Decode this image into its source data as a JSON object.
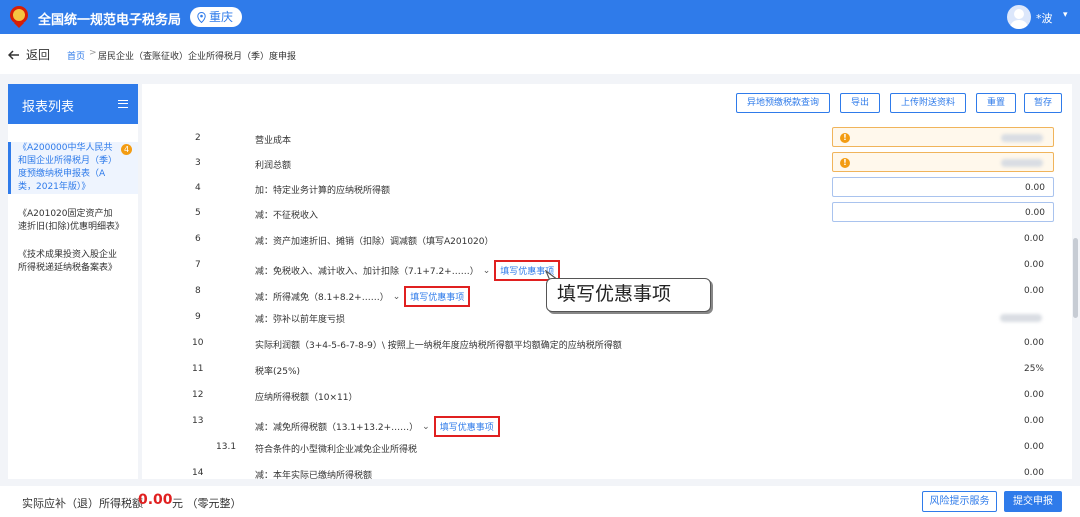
{
  "header": {
    "site_title": "全国统一规范电子税务局",
    "region": "重庆",
    "user_name": "*波"
  },
  "breadcrumb": {
    "back_label": "返回",
    "home": "首页",
    "separator": ">",
    "current": "居民企业（查账征收）企业所得税月（季）度申报"
  },
  "sidebar": {
    "title": "报表列表",
    "items": [
      {
        "label": "《A200000中华人民共和国企业所得税月（季）度预缴纳税申报表（A类，2021年版）》",
        "badge": "4",
        "active": true
      },
      {
        "label": "《A201020固定资产加速折旧(扣除)优惠明细表》"
      },
      {
        "label": "《技术成果投资入股企业所得税递延纳税备案表》"
      }
    ]
  },
  "toolbar": {
    "buttons": [
      "异地预缴税款查询",
      "导出",
      "上传附送资料",
      "重置",
      "暂存"
    ]
  },
  "form_rows": [
    {
      "num": "2",
      "label": "营业成本",
      "kind": "warn"
    },
    {
      "num": "3",
      "label": "利润总额",
      "kind": "warn"
    },
    {
      "num": "4",
      "label": "加：特定业务计算的应纳税所得额",
      "kind": "input",
      "value": "0.00"
    },
    {
      "num": "5",
      "label": "减：不征税收入",
      "kind": "input",
      "value": "0.00"
    },
    {
      "num": "6",
      "label": "减：资产加速折旧、摊销（扣除）调减额（填写A201020）",
      "kind": "plain",
      "value": "0.00"
    },
    {
      "num": "7",
      "label": "减：免税收入、减计收入、加计扣除（7.1+7.2+……）",
      "kind": "plain",
      "value": "0.00",
      "link": "填写优惠事项"
    },
    {
      "num": "8",
      "label": "减：所得减免（8.1+8.2+……）",
      "kind": "plain",
      "value": "0.00",
      "link": "填写优惠事项"
    },
    {
      "num": "9",
      "label": "减：弥补以前年度亏损",
      "kind": "blur"
    },
    {
      "num": "10",
      "label": "实际利润额（3+4-5-6-7-8-9）\\ 按照上一纳税年度应纳税所得额平均额确定的应纳税所得额",
      "kind": "plain",
      "value": "0.00"
    },
    {
      "num": "11",
      "label": "税率(25%)",
      "kind": "plain",
      "value": "25%"
    },
    {
      "num": "12",
      "label": "应纳所得税额（10×11）",
      "kind": "plain",
      "value": "0.00"
    },
    {
      "num": "13",
      "label": "减：减免所得税额（13.1+13.2+……）",
      "kind": "plain",
      "value": "0.00",
      "link": "填写优惠事项"
    },
    {
      "num": "13.1",
      "label": "符合条件的小型微利企业减免企业所得税",
      "kind": "plain",
      "value": "0.00",
      "sub": true
    },
    {
      "num": "14",
      "label": "减：本年实际已缴纳所得税额",
      "kind": "plain",
      "value": "0.00"
    }
  ],
  "callout": "填写优惠事项",
  "footer": {
    "tax_label": "实际应补（退）所得税额",
    "tax_amount": "0.00",
    "tax_unit": "元 （零元整）",
    "risk_button": "风险提示服务",
    "submit_button": "提交申报"
  },
  "colors": {
    "primary": "#2f7bea",
    "warning": "#f39c12",
    "highlight": "#e02020"
  }
}
